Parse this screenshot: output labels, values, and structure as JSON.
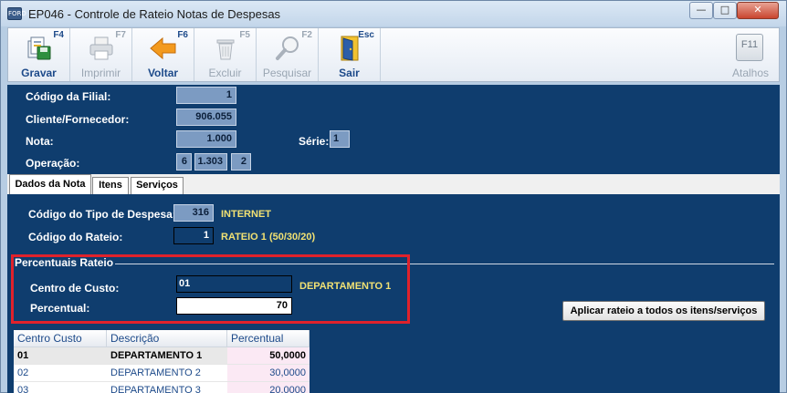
{
  "window": {
    "title": "EP046 - Controle de Rateio Notas de Despesas",
    "icon_text": "FORD",
    "controls": {
      "minimize": "—",
      "maximize": "□",
      "close": "✕"
    }
  },
  "toolbar": {
    "buttons": [
      {
        "label": "Gravar",
        "key": "F4",
        "enabled": true,
        "icon": "save-icon"
      },
      {
        "label": "Imprimir",
        "key": "F7",
        "enabled": false,
        "icon": "printer-icon"
      },
      {
        "label": "Voltar",
        "key": "F6",
        "enabled": true,
        "icon": "arrow-left-icon"
      },
      {
        "label": "Excluir",
        "key": "F5",
        "enabled": false,
        "icon": "trash-icon"
      },
      {
        "label": "Pesquisar",
        "key": "F2",
        "enabled": false,
        "icon": "magnifier-icon"
      },
      {
        "label": "Sair",
        "key": "Esc",
        "enabled": true,
        "icon": "door-exit-icon"
      }
    ],
    "atalhos": {
      "label": "Atalhos",
      "key": "F11",
      "enabled": false,
      "icon": "shortcut-icon"
    }
  },
  "header": {
    "filial_label": "Código da Filial:",
    "filial_value": "1",
    "cliente_label": "Cliente/Fornecedor:",
    "cliente_value": "906.055",
    "nota_label": "Nota:",
    "nota_value": "1.000",
    "serie_label": "Série:",
    "serie_value": "1",
    "operacao_label": "Operação:",
    "operacao_values": [
      "6",
      "1.303",
      "2"
    ]
  },
  "tabs": [
    {
      "label": "Dados da Nota",
      "active": true
    },
    {
      "label": "Itens",
      "active": false
    },
    {
      "label": "Serviços",
      "active": false
    }
  ],
  "dados": {
    "tipo_despesa_label": "Código do Tipo de Despesa:",
    "tipo_despesa_value": "316",
    "tipo_despesa_desc": "INTERNET",
    "rateio_label": "Código do Rateio:",
    "rateio_value": "1",
    "rateio_desc": "RATEIO 1 (50/30/20)"
  },
  "percentuais": {
    "legend": "Percentuais Rateio",
    "centro_label": "Centro de Custo:",
    "centro_value": "01",
    "centro_desc": "DEPARTAMENTO 1",
    "percentual_label": "Percentual:",
    "percentual_value": "70",
    "apply_button": "Aplicar rateio a todos os itens/serviços"
  },
  "table": {
    "headers": [
      "Centro Custo",
      "Descrição",
      "Percentual"
    ],
    "rows": [
      [
        "01",
        "DEPARTAMENTO 1",
        "50,0000"
      ],
      [
        "02",
        "DEPARTAMENTO 2",
        "30,0000"
      ],
      [
        "03",
        "DEPARTAMENTO 3",
        "20,0000"
      ]
    ]
  },
  "colors": {
    "panel": "#0f3d6e",
    "field": "#7c9bc2",
    "accent_text": "#f1e173",
    "highlight": "#e0222b"
  }
}
